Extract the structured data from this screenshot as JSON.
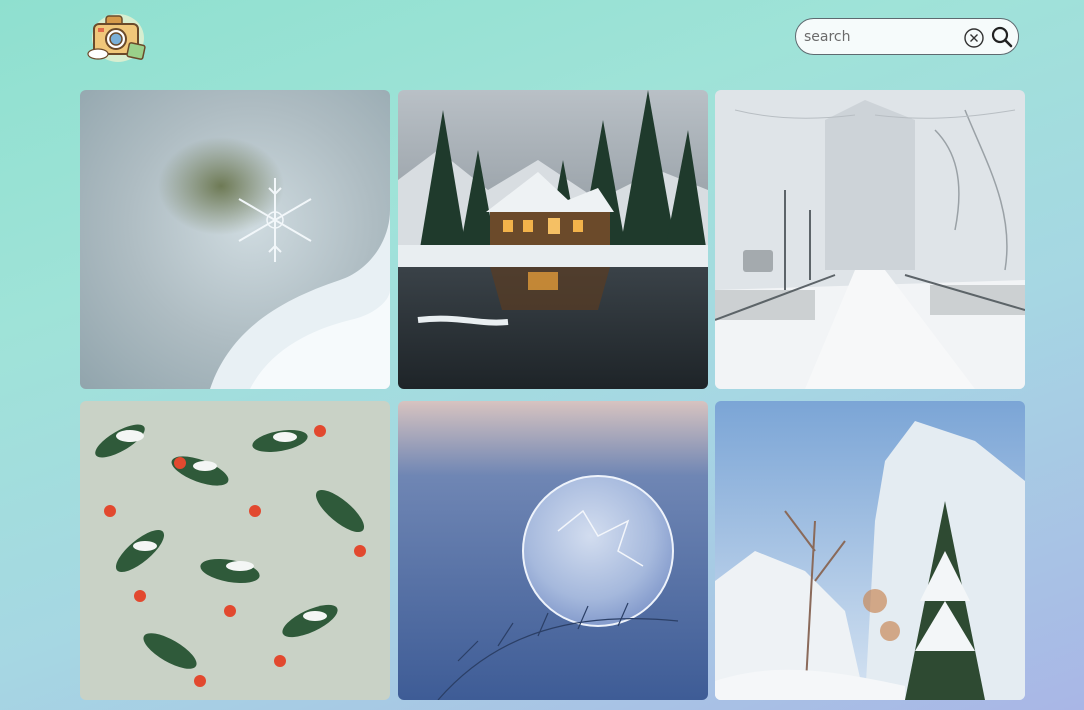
{
  "header": {
    "logo_icon": "camera-sticker-icon",
    "search": {
      "placeholder": "search",
      "value": "",
      "clear_icon": "circle-x-icon",
      "submit_icon": "magnifier-icon"
    }
  },
  "gallery": {
    "images": [
      {
        "icon": "snowflake-photo"
      },
      {
        "icon": "snowy-cabin-lake-photo"
      },
      {
        "icon": "snowy-street-photo"
      },
      {
        "icon": "snowy-berries-photo"
      },
      {
        "icon": "frozen-bubble-photo"
      },
      {
        "icon": "snowy-trees-photo"
      }
    ]
  },
  "colors": {
    "bg_top": "#8fe0cf",
    "bg_bottom": "#a9b6e6",
    "search_border": "#5e6a70"
  }
}
